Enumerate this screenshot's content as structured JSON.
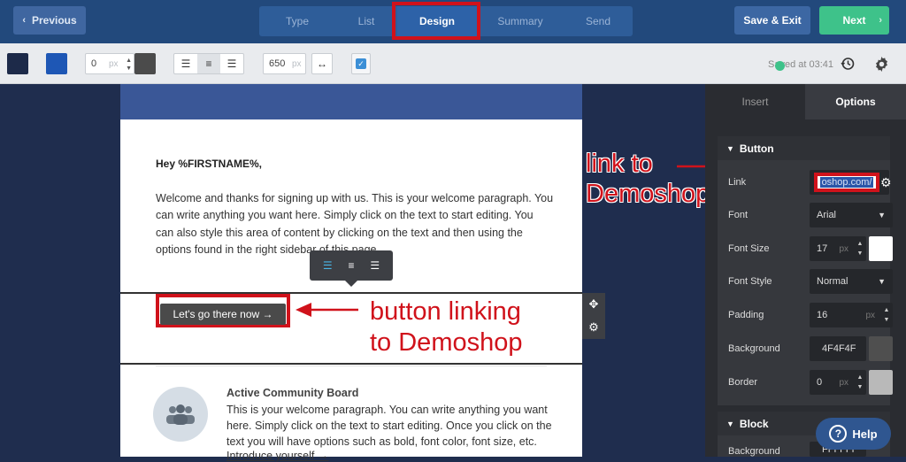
{
  "topbar": {
    "previous_label": "Previous",
    "steps": [
      "Type",
      "List",
      "Design",
      "Summary",
      "Send"
    ],
    "active_step": "Design",
    "save_exit_label": "Save & Exit",
    "next_label": "Next"
  },
  "toolbar": {
    "color1": "#1d2a49",
    "color2": "#1e57b5",
    "color3": "#4b4b4b",
    "border_value": "0",
    "border_unit": "px",
    "width_value": "650",
    "width_unit": "px",
    "saved_text": "Saved at 03:41"
  },
  "email": {
    "greeting": "Hey %FIRSTNAME%,",
    "paragraph": "Welcome and thanks for signing up with us. This is your welcome paragraph. You can write anything you want here. Simply click on the text to start editing. You can also style this area of content by clicking on the text and then using the options found in the right sidebar of this page.",
    "cta_label": "Let's go there now →",
    "community_title": "Active Community Board",
    "community_text": "This is your welcome paragraph. You can write anything you want here. Simply click on the text to start editing. Once you click on the text you will have options such as bold, font color, font size, etc.",
    "community_link": "Introduce yourself →"
  },
  "annotations": {
    "link_note_1": "link to",
    "link_note_2": "Demoshop",
    "button_note_1": "button linking",
    "button_note_2": "to Demoshop"
  },
  "panel": {
    "tab_insert": "Insert",
    "tab_options": "Options",
    "button_section": "Button",
    "link_label": "Link",
    "link_value": "oshop.com/",
    "font_label": "Font",
    "font_value": "Arial",
    "font_size_label": "Font Size",
    "font_size_value": "17",
    "font_style_label": "Font Style",
    "font_style_value": "Normal",
    "padding_label": "Padding",
    "padding_value": "16",
    "background_label": "Background",
    "background_value": "4F4F4F",
    "border_label": "Border",
    "border_value": "0",
    "unit": "px",
    "block_section": "Block",
    "block_bg_label": "Background",
    "block_bg_value": "FFFFFF",
    "help_label": "Help"
  },
  "colors": {
    "accent_red": "#d0121b",
    "next_green": "#3ec28a"
  }
}
